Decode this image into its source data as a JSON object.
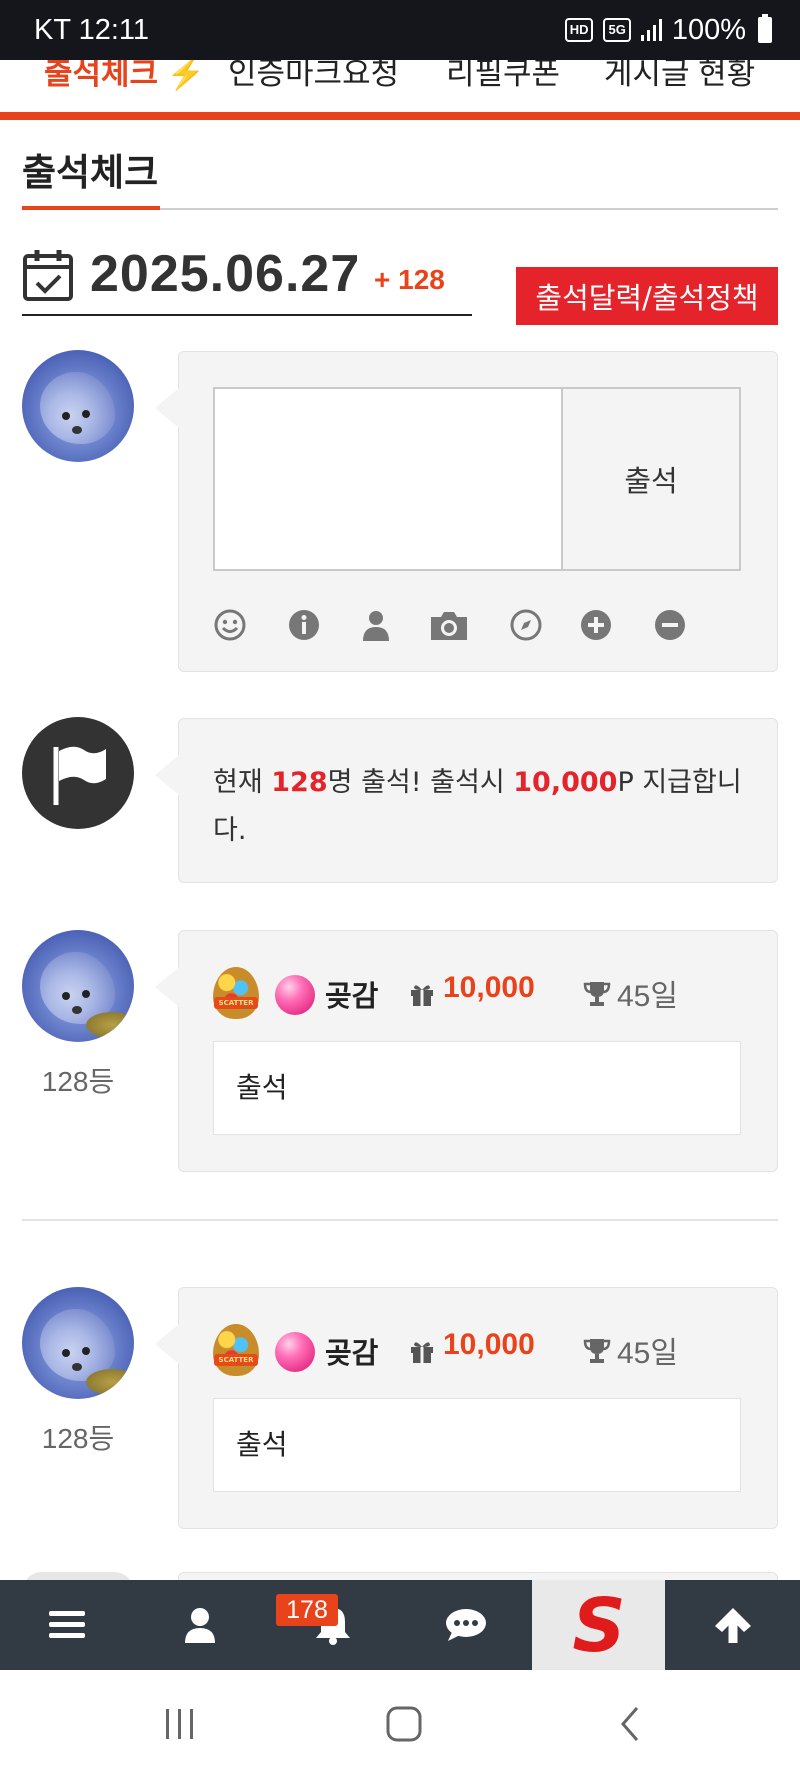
{
  "status_bar": {
    "carrier_time": "KT 12:11",
    "battery": "100%",
    "hd_label": "HD",
    "net_label": "5G"
  },
  "top_tabs": [
    {
      "label": "출석체크 ⚡"
    },
    {
      "label": "인증마크요청"
    },
    {
      "label": "리필쿠폰"
    },
    {
      "label": "게시글 현황"
    }
  ],
  "section": {
    "title": "출석체크"
  },
  "date_row": {
    "date": "2025.06.27",
    "count": "+ 128",
    "calendar_button": "출석달력/출석정책"
  },
  "write_box": {
    "textarea_placeholder": "",
    "submit_label": "출석",
    "tools": [
      "smile-icon",
      "info-icon",
      "user-icon",
      "camera-icon",
      "compass-icon",
      "plus-circle-icon",
      "minus-circle-icon"
    ]
  },
  "notice": {
    "pre": "현재 ",
    "count": "128",
    "mid": "명 출석! 출석시 ",
    "points": "10,000",
    "post": "P 지급합니다."
  },
  "posts": [
    {
      "rank": "128등",
      "nickname": "곶감",
      "points": "10,000",
      "days": "45일",
      "message": "출석",
      "badge_text": "SCATTER"
    },
    {
      "rank": "128등",
      "nickname": "곶감",
      "points": "10,000",
      "days": "45일",
      "message": "출석",
      "badge_text": "SCATTER"
    }
  ],
  "bottom_nav": {
    "items": [
      "menu-icon",
      "user-icon",
      "bell-icon",
      "chat-icon",
      "site-logo",
      "arrow-up-icon"
    ],
    "notification_count": "178",
    "logo_letter": "S"
  },
  "colors": {
    "accent": "#e8431b",
    "red_button": "#e5232b",
    "nav_bg": "#323a44",
    "status_bg": "#14161c"
  }
}
